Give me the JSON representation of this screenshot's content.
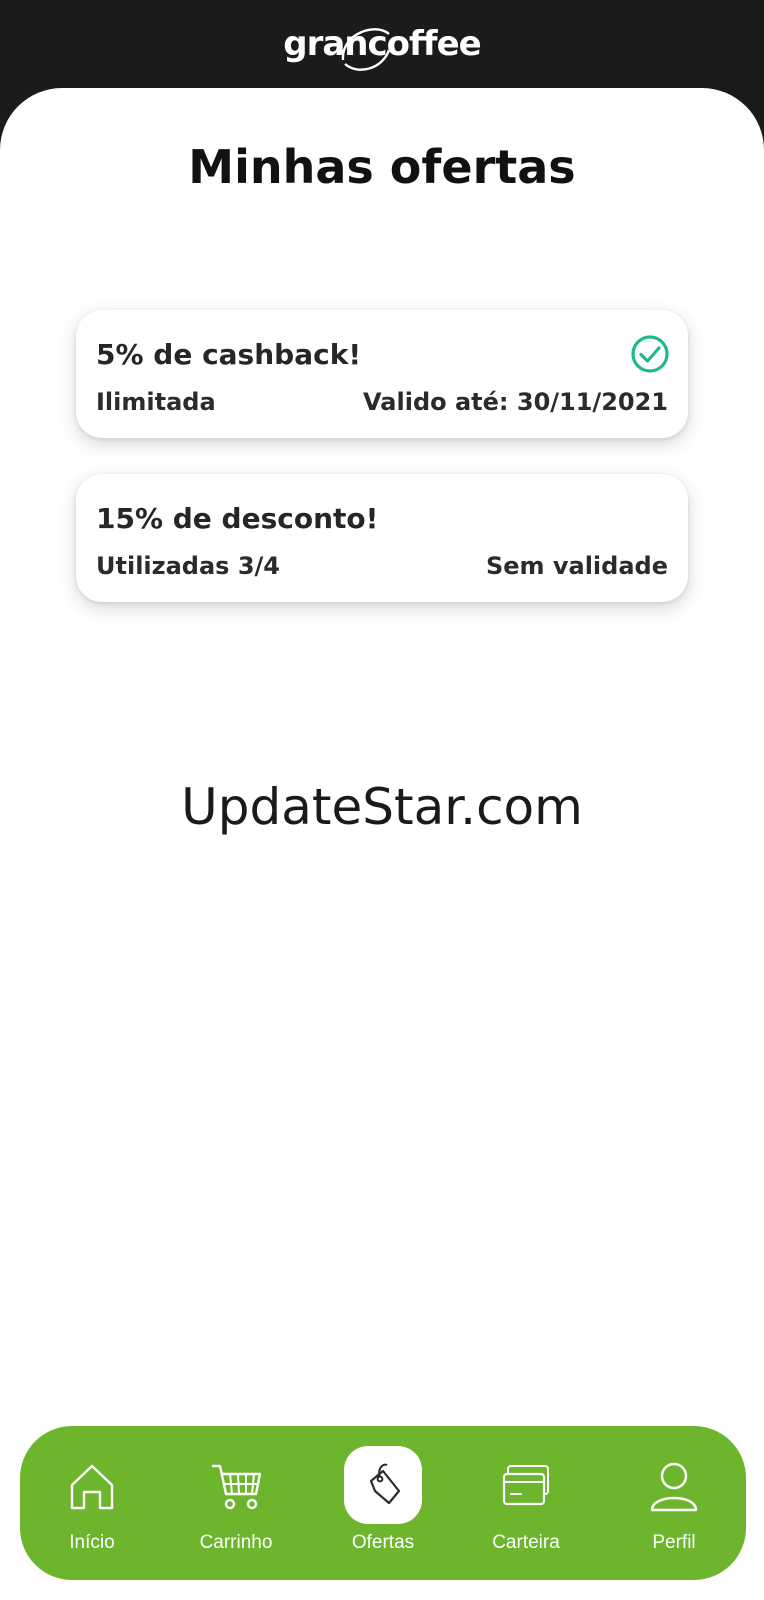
{
  "header": {
    "logo_text": "grancoffee"
  },
  "page": {
    "title": "Minhas ofertas"
  },
  "offers": [
    {
      "title": "5% de cashback!",
      "left_text": "Ilimitada",
      "right_text": "Valido até: 30/11/2021",
      "active": true
    },
    {
      "title": "15% de desconto!",
      "left_text": "Utilizadas 3/4",
      "right_text": "Sem validade",
      "active": false
    }
  ],
  "watermark": "UpdateStar.com",
  "nav": {
    "items": [
      {
        "label": "Início",
        "icon": "home-icon"
      },
      {
        "label": "Carrinho",
        "icon": "cart-icon"
      },
      {
        "label": "Ofertas",
        "icon": "tag-icon",
        "active": true
      },
      {
        "label": "Carteira",
        "icon": "wallet-icon"
      },
      {
        "label": "Perfil",
        "icon": "profile-icon"
      }
    ]
  },
  "colors": {
    "header_bg": "#1c1a1a",
    "accent_green": "#6db52c",
    "check_green": "#1fb985",
    "text_dark": "#262626"
  }
}
